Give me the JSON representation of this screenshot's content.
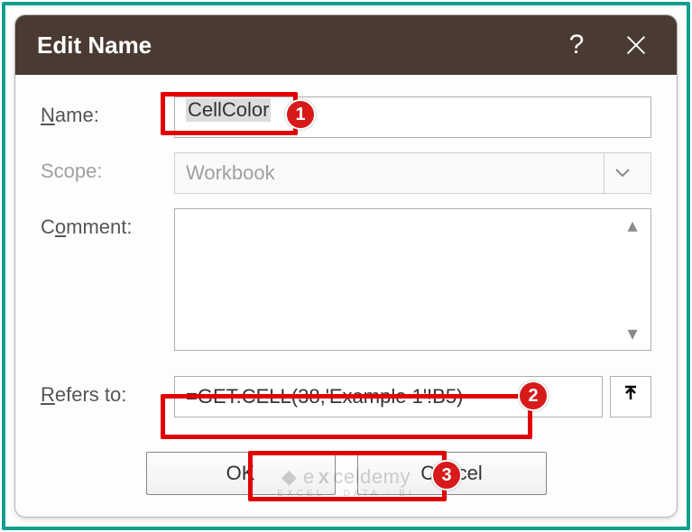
{
  "titlebar": {
    "title": "Edit Name",
    "help": "?",
    "close": "✕"
  },
  "labels": {
    "name_prefix": "N",
    "name_rest": "ame:",
    "scope": "Scope:",
    "comment_prefix": "C",
    "comment_mn": "o",
    "comment_rest": "mment:",
    "refers_prefix": "R",
    "refers_rest": "efers to:"
  },
  "fields": {
    "name_value": "CellColor",
    "scope_value": "Workbook",
    "comment_value": "",
    "refers_value": "=GET.CELL(38,'Example 1'!B5)"
  },
  "buttons": {
    "ok": "OK",
    "cancel": "Cancel",
    "collapse": "⬆"
  },
  "annotations": {
    "b1": "1",
    "b2": "2",
    "b3": "3"
  },
  "watermark": {
    "main_pre": "◆ e",
    "main_bold": "x",
    "main_post": "celdemy",
    "sub": "EXCEL · DATA · BI"
  }
}
